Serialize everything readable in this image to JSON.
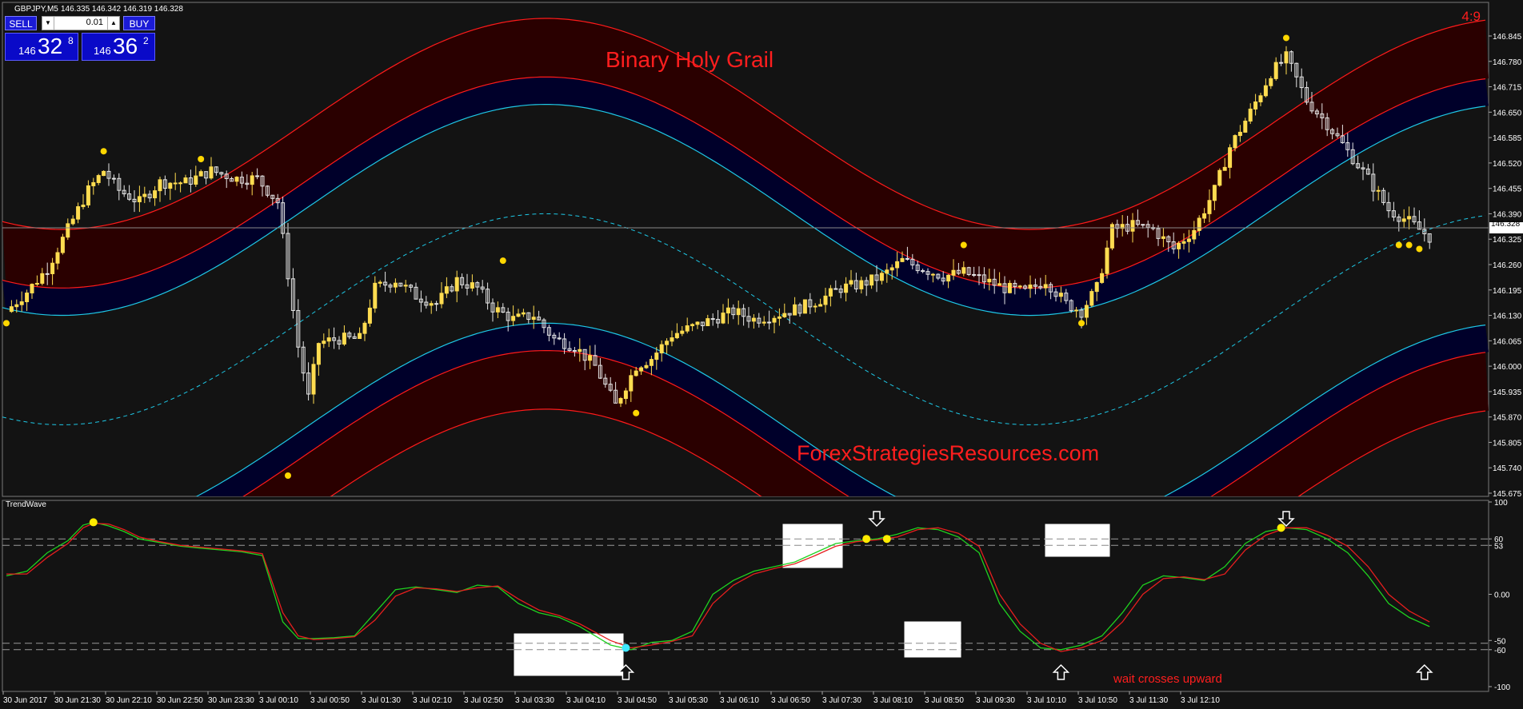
{
  "chart_header": {
    "symbol": "GBPJPY,M5",
    "ohlc": "146.335 146.342 146.319 146.328",
    "timer": "4:9"
  },
  "trade_panel": {
    "sell_label": "SELL",
    "buy_label": "BUY",
    "lot": "0.01",
    "sell_small": "146",
    "sell_big": "32",
    "sell_sup": "8",
    "buy_small": "146",
    "buy_big": "36",
    "buy_sup": "2"
  },
  "annotations": {
    "title": "Binary Holy Grail",
    "watermark": "ForexStrategiesResources.com",
    "hint": "wait crosses upward"
  },
  "indicator_name": "TrendWave",
  "colors": {
    "background": "#131313",
    "band_outer": "#2a0000",
    "band_inner": "#00002a",
    "red_line": "#ff1a1a",
    "cyan_line": "#1ec8e6",
    "candle_bull": "#ffdc50",
    "candle_bear": "#e6e6e6",
    "dot": "#ffd700",
    "green_line": "#1fd21f",
    "red_osc": "#e61e1e",
    "text_red": "#ff1e1e"
  },
  "chart_data": [
    {
      "type": "candlestick",
      "symbol": "GBPJPY",
      "timeframe": "M5",
      "y_ticks": [
        "146.845",
        "146.780",
        "146.715",
        "146.650",
        "146.585",
        "146.520",
        "146.455",
        "146.390",
        "146.325",
        "146.260",
        "146.195",
        "146.130",
        "146.065",
        "146.000",
        "145.935",
        "145.870",
        "145.805",
        "145.740",
        "145.675"
      ],
      "current_price": "146.328",
      "ylim": [
        145.675,
        146.875
      ],
      "x_ticks": [
        "30 Jun 2017",
        "30 Jun 21:30",
        "30 Jun 22:10",
        "30 Jun 22:50",
        "30 Jun 23:30",
        "3 Jul 00:10",
        "3 Jul 00:50",
        "3 Jul 01:30",
        "3 Jul 02:10",
        "3 Jul 02:50",
        "3 Jul 03:30",
        "3 Jul 04:10",
        "3 Jul 04:50",
        "3 Jul 05:30",
        "3 Jul 06:10",
        "3 Jul 06:50",
        "3 Jul 07:30",
        "3 Jul 08:10",
        "3 Jul 08:50",
        "3 Jul 09:30",
        "3 Jul 10:10",
        "3 Jul 10:50",
        "3 Jul 11:30",
        "3 Jul 12:10"
      ],
      "close_path": [
        [
          0,
          146.14
        ],
        [
          4,
          146.19
        ],
        [
          8,
          146.25
        ],
        [
          12,
          146.35
        ],
        [
          16,
          146.45
        ],
        [
          19,
          146.5
        ],
        [
          22,
          146.45
        ],
        [
          26,
          146.42
        ],
        [
          30,
          146.47
        ],
        [
          35,
          146.47
        ],
        [
          40,
          146.5
        ],
        [
          45,
          146.48
        ],
        [
          49,
          146.48
        ],
        [
          53,
          146.42
        ],
        [
          57,
          146.05
        ],
        [
          59,
          145.92
        ],
        [
          61,
          146.06
        ],
        [
          65,
          146.07
        ],
        [
          69,
          146.07
        ],
        [
          72,
          146.2
        ],
        [
          76,
          146.22
        ],
        [
          80,
          146.18
        ],
        [
          84,
          146.16
        ],
        [
          88,
          146.22
        ],
        [
          92,
          146.2
        ],
        [
          95,
          146.15
        ],
        [
          99,
          146.12
        ],
        [
          103,
          146.13
        ],
        [
          107,
          146.07
        ],
        [
          111,
          146.05
        ],
        [
          115,
          146.0
        ],
        [
          119,
          145.9
        ],
        [
          123,
          146.0
        ],
        [
          126,
          146.02
        ],
        [
          130,
          146.08
        ],
        [
          134,
          146.1
        ],
        [
          138,
          146.12
        ],
        [
          142,
          146.14
        ],
        [
          146,
          146.12
        ],
        [
          150,
          146.13
        ],
        [
          155,
          146.15
        ],
        [
          159,
          146.17
        ],
        [
          163,
          146.2
        ],
        [
          167,
          146.21
        ],
        [
          171,
          146.23
        ],
        [
          175,
          146.27
        ],
        [
          179,
          146.25
        ],
        [
          183,
          146.23
        ],
        [
          187,
          146.24
        ],
        [
          191,
          146.22
        ],
        [
          195,
          146.2
        ],
        [
          199,
          146.19
        ],
        [
          203,
          146.22
        ],
        [
          207,
          146.16
        ],
        [
          210,
          146.14
        ],
        [
          213,
          146.2
        ],
        [
          216,
          146.35
        ],
        [
          220,
          146.36
        ],
        [
          224,
          146.35
        ],
        [
          228,
          146.3
        ],
        [
          232,
          146.35
        ],
        [
          236,
          146.45
        ],
        [
          239,
          146.56
        ],
        [
          243,
          146.65
        ],
        [
          247,
          146.75
        ],
        [
          250,
          146.79
        ],
        [
          254,
          146.68
        ],
        [
          258,
          146.62
        ],
        [
          262,
          146.55
        ],
        [
          266,
          146.48
        ],
        [
          270,
          146.4
        ],
        [
          274,
          146.37
        ],
        [
          278,
          146.33
        ]
      ],
      "signal_dots_sell": [
        [
          19,
          146.55
        ],
        [
          38,
          146.53
        ],
        [
          97,
          146.27
        ],
        [
          187,
          146.31
        ],
        [
          250,
          146.84
        ]
      ],
      "signal_dots_buy": [
        [
          0,
          146.11
        ],
        [
          55,
          145.72
        ],
        [
          123,
          145.88
        ],
        [
          210,
          146.11
        ],
        [
          272,
          146.31
        ],
        [
          274,
          146.31
        ],
        [
          276,
          146.3
        ]
      ],
      "bands_note": "Outer red and inner cyan envelope bands with dashed cyan midline"
    },
    {
      "type": "line",
      "name": "TrendWave",
      "y_ticks": [
        "100",
        "60",
        "53",
        "0.00",
        "-50",
        "-60",
        "-100"
      ],
      "ylim": [
        -100,
        100
      ],
      "levels": [
        60,
        53,
        -53,
        -60
      ],
      "series": [
        {
          "color": "green",
          "points": [
            [
              0,
              20
            ],
            [
              4,
              25
            ],
            [
              8,
              45
            ],
            [
              12,
              58
            ],
            [
              15,
              75
            ],
            [
              17,
              78
            ],
            [
              20,
              74
            ],
            [
              23,
              68
            ],
            [
              26,
              60
            ],
            [
              30,
              56
            ],
            [
              34,
              52
            ],
            [
              38,
              50
            ],
            [
              42,
              48
            ],
            [
              46,
              46
            ],
            [
              50,
              42
            ],
            [
              54,
              -30
            ],
            [
              57,
              -48
            ],
            [
              60,
              -48
            ],
            [
              64,
              -47
            ],
            [
              68,
              -45
            ],
            [
              72,
              -20
            ],
            [
              76,
              5
            ],
            [
              80,
              8
            ],
            [
              84,
              5
            ],
            [
              88,
              2
            ],
            [
              92,
              10
            ],
            [
              96,
              8
            ],
            [
              100,
              -10
            ],
            [
              104,
              -20
            ],
            [
              108,
              -25
            ],
            [
              112,
              -35
            ],
            [
              118,
              -55
            ],
            [
              122,
              -60
            ],
            [
              126,
              -52
            ],
            [
              130,
              -50
            ],
            [
              134,
              -40
            ],
            [
              138,
              0
            ],
            [
              142,
              15
            ],
            [
              146,
              25
            ],
            [
              150,
              30
            ],
            [
              154,
              35
            ],
            [
              158,
              45
            ],
            [
              162,
              55
            ],
            [
              166,
              58
            ],
            [
              170,
              60
            ],
            [
              174,
              65
            ],
            [
              178,
              72
            ],
            [
              182,
              70
            ],
            [
              186,
              62
            ],
            [
              190,
              45
            ],
            [
              194,
              -10
            ],
            [
              198,
              -40
            ],
            [
              202,
              -58
            ],
            [
              206,
              -60
            ],
            [
              210,
              -55
            ],
            [
              214,
              -45
            ],
            [
              218,
              -20
            ],
            [
              222,
              10
            ],
            [
              226,
              20
            ],
            [
              230,
              18
            ],
            [
              234,
              15
            ],
            [
              238,
              30
            ],
            [
              242,
              55
            ],
            [
              246,
              68
            ],
            [
              250,
              72
            ],
            [
              254,
              70
            ],
            [
              258,
              60
            ],
            [
              262,
              45
            ],
            [
              266,
              20
            ],
            [
              270,
              -10
            ],
            [
              274,
              -25
            ],
            [
              278,
              -35
            ]
          ]
        },
        {
          "color": "red",
          "points": [
            [
              0,
              22
            ],
            [
              4,
              22
            ],
            [
              8,
              40
            ],
            [
              12,
              55
            ],
            [
              15,
              72
            ],
            [
              17,
              77
            ],
            [
              20,
              76
            ],
            [
              23,
              70
            ],
            [
              26,
              62
            ],
            [
              30,
              57
            ],
            [
              34,
              53
            ],
            [
              38,
              51
            ],
            [
              42,
              49
            ],
            [
              46,
              47
            ],
            [
              50,
              44
            ],
            [
              54,
              -20
            ],
            [
              57,
              -45
            ],
            [
              60,
              -49
            ],
            [
              64,
              -48
            ],
            [
              68,
              -46
            ],
            [
              72,
              -28
            ],
            [
              76,
              -2
            ],
            [
              80,
              7
            ],
            [
              84,
              6
            ],
            [
              88,
              3
            ],
            [
              92,
              7
            ],
            [
              96,
              9
            ],
            [
              100,
              -5
            ],
            [
              104,
              -17
            ],
            [
              108,
              -23
            ],
            [
              112,
              -32
            ],
            [
              118,
              -50
            ],
            [
              122,
              -58
            ],
            [
              126,
              -55
            ],
            [
              130,
              -51
            ],
            [
              134,
              -45
            ],
            [
              138,
              -10
            ],
            [
              142,
              10
            ],
            [
              146,
              22
            ],
            [
              150,
              28
            ],
            [
              154,
              33
            ],
            [
              158,
              42
            ],
            [
              162,
              52
            ],
            [
              166,
              57
            ],
            [
              170,
              59
            ],
            [
              174,
              62
            ],
            [
              178,
              70
            ],
            [
              182,
              72
            ],
            [
              186,
              66
            ],
            [
              190,
              52
            ],
            [
              194,
              0
            ],
            [
              198,
              -32
            ],
            [
              202,
              -53
            ],
            [
              206,
              -62
            ],
            [
              210,
              -58
            ],
            [
              214,
              -50
            ],
            [
              218,
              -30
            ],
            [
              222,
              0
            ],
            [
              226,
              17
            ],
            [
              230,
              19
            ],
            [
              234,
              16
            ],
            [
              238,
              22
            ],
            [
              242,
              48
            ],
            [
              246,
              64
            ],
            [
              250,
              72
            ],
            [
              254,
              72
            ],
            [
              258,
              64
            ],
            [
              262,
              52
            ],
            [
              266,
              30
            ],
            [
              270,
              0
            ],
            [
              274,
              -18
            ],
            [
              278,
              -30
            ]
          ]
        }
      ],
      "signal_dots": [
        {
          "x": 17,
          "y": 78,
          "color": "yellow"
        },
        {
          "x": 121,
          "y": -58,
          "color": "cyan"
        },
        {
          "x": 168,
          "y": 60,
          "color": "yellow"
        },
        {
          "x": 172,
          "y": 60,
          "color": "yellow"
        },
        {
          "x": 249,
          "y": 72,
          "color": "yellow"
        }
      ],
      "arrows": [
        {
          "x": 121,
          "dir": "up"
        },
        {
          "x": 170,
          "dir": "down"
        },
        {
          "x": 206,
          "dir": "up"
        },
        {
          "x": 250,
          "dir": "down"
        },
        {
          "x": 277,
          "dir": "up"
        }
      ]
    }
  ]
}
